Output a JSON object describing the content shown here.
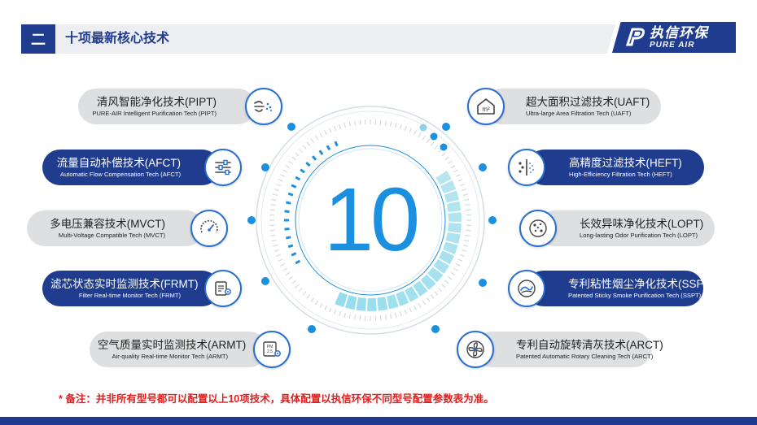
{
  "header": {
    "section_number": "二",
    "title": "十项最新核心技术"
  },
  "logo": {
    "cn": "执信环保",
    "en": "PURE AIR"
  },
  "center": {
    "number": "10"
  },
  "left_items": [
    {
      "cn": "清风智能净化技术(PIPT)",
      "en": "PURE-AIR Intelligent Purification Tech (PIPT)",
      "style": "light",
      "icon": "wind-icon"
    },
    {
      "cn": "流量自动补偿技术(AFCT)",
      "en": "Automatic Flow Compensation Tech (AFCT)",
      "style": "dark",
      "icon": "sliders-icon"
    },
    {
      "cn": "多电压兼容技术(MVCT)",
      "en": "Multi-Voltage Compatible Tech (MVCT)",
      "style": "light",
      "icon": "gauge-icon"
    },
    {
      "cn": "滤芯状态实时监测技术(FRMT)",
      "en": "Filter Real-time Monitor Tech (FRMT)",
      "style": "dark",
      "icon": "monitor-gear-icon"
    },
    {
      "cn": "空气质量实时监测技术(ARMT)",
      "en": "Air-quality Real-time Monitor Tech (ARMT)",
      "style": "light",
      "icon": "pm25-gear-icon"
    }
  ],
  "right_items": [
    {
      "cn": "超大面积过滤技术(UAFT)",
      "en": "Ultra-large Area Filtration Tech (UAFT)",
      "style": "light",
      "icon": "house-m2-icon"
    },
    {
      "cn": "高精度过滤技术(HEFT)",
      "en": "High-Efficiency Filtration Tech (HEFT)",
      "style": "dark",
      "icon": "filter-particles-icon"
    },
    {
      "cn": "长效异味净化技术(LOPT)",
      "en": "Long-lasting Odor Purification Tech (LOPT)",
      "style": "light",
      "icon": "odor-particles-icon"
    },
    {
      "cn": "专利粘性烟尘净化技术(SSPT)",
      "en": "Patented Sticky Smoke Purification Tech (SSPT)",
      "style": "dark",
      "icon": "smoke-swirl-icon"
    },
    {
      "cn": "专利自动旋转清灰技术(ARCT)",
      "en": "Patented Automatic Rotary Cleaning Tech (ARCT)",
      "style": "light",
      "icon": "fan-icon"
    }
  ],
  "note": "* 备注：并非所有型号都可以配置以上10项技术，具体配置以执信环保不同型号配置参数表为准。",
  "colors": {
    "brand": "#1f3c8f",
    "accent": "#1b8fe0",
    "pill_light": "#dedfe0",
    "note": "#e02020"
  }
}
